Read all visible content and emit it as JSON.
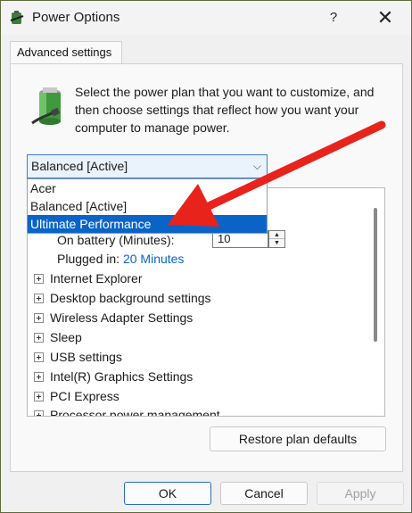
{
  "window": {
    "title": "Power Options",
    "help": "?",
    "close": "✕"
  },
  "tab": {
    "label": "Advanced settings"
  },
  "description": "Select the power plan that you want to customize, and then choose settings that reflect how you want your computer to manage power.",
  "plan_select": {
    "value": "Balanced [Active]",
    "options": [
      "Acer",
      "Balanced [Active]",
      "Ultimate Performance"
    ],
    "highlighted": "Ultimate Performance"
  },
  "tree": {
    "on_battery_label": "On battery (Minutes):",
    "on_battery_value": "10",
    "plugged_in_label": "Plugged in:",
    "plugged_in_value": "20 Minutes",
    "items": [
      "Internet Explorer",
      "Desktop background settings",
      "Wireless Adapter Settings",
      "Sleep",
      "USB settings",
      "Intel(R) Graphics Settings",
      "PCI Express",
      "Processor power management"
    ]
  },
  "buttons": {
    "restore": "Restore plan defaults",
    "ok": "OK",
    "cancel": "Cancel",
    "apply": "Apply"
  },
  "colors": {
    "accent": "#0a64c8",
    "annotation_arrow": "#e8231c"
  }
}
